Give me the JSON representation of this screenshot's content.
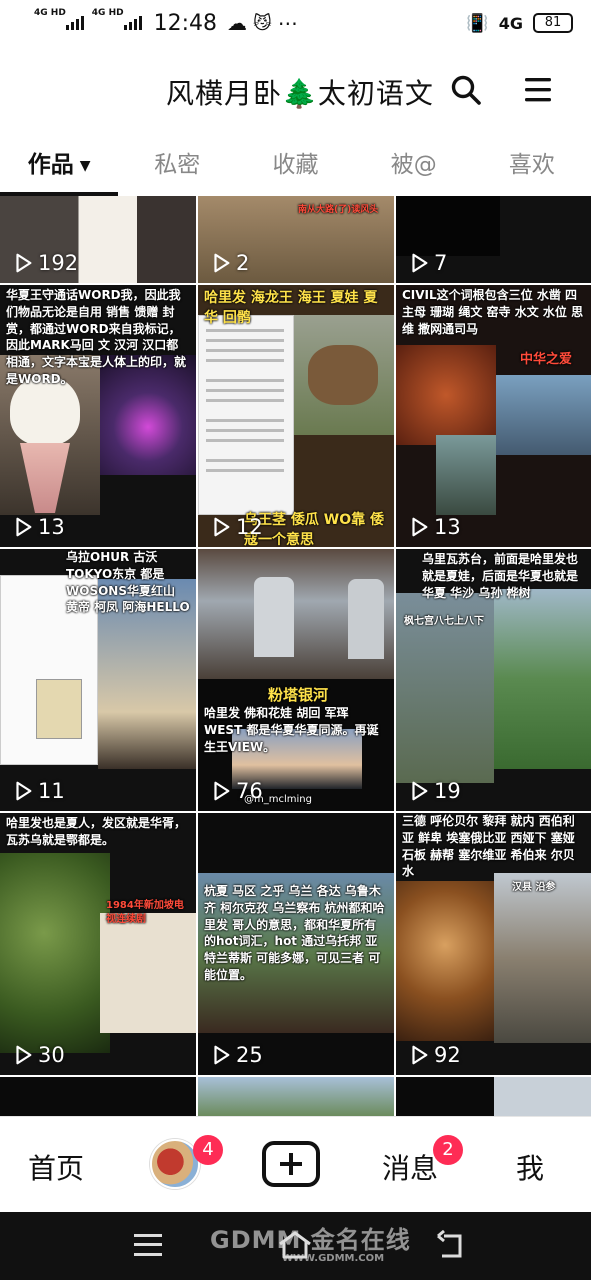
{
  "status_bar": {
    "signal1": "4G HD",
    "signal2": "4G HD",
    "time": "12:48",
    "network": "4G",
    "battery": "81"
  },
  "header": {
    "title": "风横月卧🌲太初语文"
  },
  "tabs": [
    {
      "label": "作品",
      "active": true
    },
    {
      "label": "私密"
    },
    {
      "label": "收藏"
    },
    {
      "label": "被@"
    },
    {
      "label": "喜欢"
    }
  ],
  "grid": {
    "items": [
      {
        "views": "192"
      },
      {
        "views": "2",
        "caption": "南从大路(了)读风头"
      },
      {
        "views": "7"
      },
      {
        "views": "13",
        "caption": "华夏王守通话WORD我，因此我们物品无论是自用 销售 馈赠 封赏，都通过WORD来自我标记，因此MARK马回 文 汉河 汉口都相通，文字本宝是人体上的印，就是WORD。"
      },
      {
        "views": "12",
        "caption": "哈里发 海龙王 海王 夏娃 夏华 回鹘",
        "caption2": "乌王茎 倭瓜 WO靠 倭寇一个意思"
      },
      {
        "views": "13",
        "caption": "CIVIL这个词根包含三位 水凿 四主母 珊瑚 绳文 窑寺 水文 水位 思维 撒网通司马",
        "caption2": "中华之爱"
      },
      {
        "views": "11",
        "caption": "乌拉OHUR 古沃TOKYO东京 都是WOSONS华夏红山 黄帝 柯凤 阿海HELLO"
      },
      {
        "views": "76",
        "caption": "粉塔银河",
        "caption2": "哈里发 佛和花娃 胡回 军珲 WEST 都是华夏华夏同源。再诞生王VIEW。",
        "watermark": "@m_mclming"
      },
      {
        "views": "19",
        "caption": "乌里瓦苏台，前面是哈里发也就是夏娃，后面是华夏也就是华夏 华沙 乌孙 桦树",
        "caption2": "枫七宫八七上八下"
      },
      {
        "views": "30",
        "caption": "哈里发也是夏人，发区就是华胥，瓦苏乌就是鄂都是。",
        "caption2": "1984年新加坡电视连续剧"
      },
      {
        "views": "25",
        "caption": "杭夏 马区 之乎 乌兰 各达 乌鲁木齐 柯尔克孜 乌兰察布 杭州都和哈里发 哥人的意思，都和华夏所有的hot词汇，hot 通过乌托邦 亚特兰蒂斯 可能多娜，可见三者 可能位置。"
      },
      {
        "views": "92",
        "caption": "三德 呼伦贝尔 黎拜 就内 西伯利亚 鲜卑 埃塞俄比亚 西娅下 塞娅 石板 赫帮 塞尔维亚 希伯来 尔贝水",
        "caption2": "汉县 沿参"
      }
    ]
  },
  "bottom_nav": {
    "home": "首页",
    "avatar_badge": "4",
    "messages": "消息",
    "messages_badge": "2",
    "me": "我"
  },
  "system_nav": {
    "watermark": "GDMM 金名在线",
    "watermark_url": "WWW.GDMM.COM"
  }
}
